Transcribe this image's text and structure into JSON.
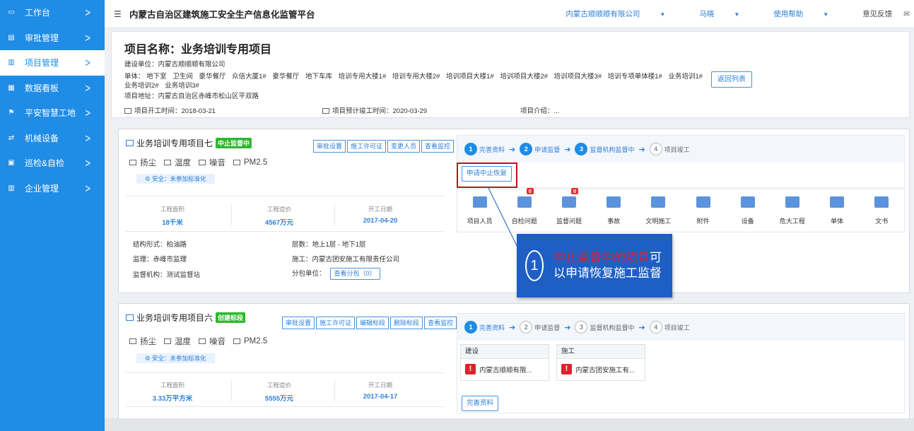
{
  "sidebar": {
    "items": [
      {
        "icon": "monitor-icon",
        "label": "工作台"
      },
      {
        "icon": "document-icon",
        "label": "审批管理"
      },
      {
        "icon": "building-icon",
        "label": "项目管理"
      },
      {
        "icon": "chart-icon",
        "label": "数据看板"
      },
      {
        "icon": "flag-icon",
        "label": "平安智慧工地"
      },
      {
        "icon": "machine-icon",
        "label": "机械设备"
      },
      {
        "icon": "clipboard-icon",
        "label": "巡检&自检"
      },
      {
        "icon": "company-icon",
        "label": "企业管理"
      }
    ]
  },
  "topbar": {
    "title": "内蒙古自治区建筑施工安全生产信息化监管平台",
    "company": "内蒙古顺顺顺有限公司",
    "user": "马晓",
    "help": "使用帮助",
    "feedback": "意见反馈"
  },
  "project": {
    "title": "项目名称：业务培训专用项目",
    "builder": "建设单位：内蒙古顺顺顺有限公司",
    "units_label": "单体：",
    "units": [
      "地下室",
      "卫生间",
      "豪华餐厅",
      "众信大厦1#",
      "豪华餐厅",
      "地下车库",
      "培训专用大楼1#",
      "培训专用大楼2#",
      "培训项目大楼1#",
      "培训项目大楼2#",
      "培训项目大楼3#",
      "培训专项单体楼1#",
      "业务培训1#",
      "业务培训2#",
      "业务培训3#"
    ],
    "address": "项目地址：内蒙古自治区赤峰市松山区平双路",
    "start": "项目开工时间：2018-03-21",
    "finish": "项目预计竣工时间：2020-03-29",
    "intro": "项目介绍：...",
    "back": "返回列表"
  },
  "card1": {
    "name": "业务培训专用项目七",
    "badge": "中止监督中",
    "buttons": [
      "审批设置",
      "施工许可证",
      "变更人员",
      "查看监控"
    ],
    "sensors": [
      "扬尘",
      "温度",
      "噪音",
      "PM2.5"
    ],
    "safety": "安全：未参加标准化",
    "stats": [
      {
        "label": "工程面积",
        "value": "18千米"
      },
      {
        "label": "工程造价",
        "value": "4567万元"
      },
      {
        "label": "开工日期",
        "value": "2017-04-20"
      }
    ],
    "structure": "结构形式：柏油路",
    "floors": "层数：地上1层 - 地下1层",
    "supervisor": "监理：赤峰市监理",
    "builder": "施工：内蒙古团安施工有限责任公司",
    "agency": "监督机构：测试监督站",
    "subcontract": "分包单位：",
    "sub_btn": "查看分包（0）",
    "steps": [
      {
        "n": "1",
        "label": "完善资料"
      },
      {
        "n": "2",
        "label": "申请监督"
      },
      {
        "n": "3",
        "label": "监督机构监督中"
      },
      {
        "n": "4",
        "label": "项目竣工"
      }
    ],
    "request_btn": "申请中止恢复",
    "icons": [
      {
        "icon": "people-icon",
        "label": "项目人员",
        "badge": ""
      },
      {
        "icon": "inspect-icon",
        "label": "自检问题",
        "badge": "0"
      },
      {
        "icon": "shield-icon",
        "label": "监督问题",
        "badge": "0"
      },
      {
        "icon": "horn-icon",
        "label": "事故",
        "badge": ""
      },
      {
        "icon": "worker-icon",
        "label": "文明施工",
        "badge": ""
      },
      {
        "icon": "attachment-icon",
        "label": "附件",
        "badge": ""
      },
      {
        "icon": "equipment-icon",
        "label": "设备",
        "badge": ""
      },
      {
        "icon": "warning-icon",
        "label": "危大工程",
        "badge": ""
      },
      {
        "icon": "grid-icon",
        "label": "单体",
        "badge": ""
      },
      {
        "icon": "doc-icon",
        "label": "文书",
        "badge": ""
      }
    ]
  },
  "card2": {
    "name": "业务培训专用项目六",
    "badge": "创建标段",
    "buttons": [
      "审批设置",
      "施工许可证",
      "编辑标段",
      "删除标段",
      "查看监控"
    ],
    "sensors": [
      "扬尘",
      "温度",
      "噪音",
      "PM2.5"
    ],
    "safety": "安全：未参加标准化",
    "stats": [
      {
        "label": "工程面积",
        "value": "3.33万平方米"
      },
      {
        "label": "工程造价",
        "value": "5555万元"
      },
      {
        "label": "开工日期",
        "value": "2017-04-17"
      }
    ],
    "steps": [
      {
        "n": "1",
        "label": "完善资料"
      },
      {
        "n": "2",
        "label": "申请监督"
      },
      {
        "n": "3",
        "label": "监督机构监督中"
      },
      {
        "n": "4",
        "label": "项目竣工"
      }
    ],
    "tile1_head": "建设",
    "tile1_body": "内蒙古顺顺有限...",
    "tile2_head": "施工",
    "tile2_body": "内蒙古团安施工有...",
    "complete_btn": "完善资料"
  },
  "callout": {
    "number": "1",
    "red_text": "中止监督中的项目",
    "text": "可以申请恢复施工监督"
  }
}
